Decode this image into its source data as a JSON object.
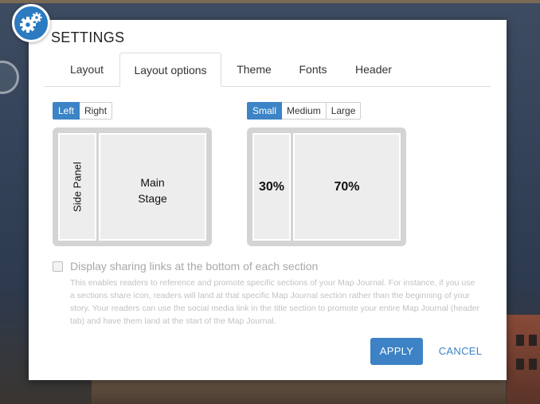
{
  "dialog": {
    "title": "SETTINGS",
    "icon": "gears-icon",
    "accent_color": "#3d82c4"
  },
  "tabs": [
    {
      "label": "Layout",
      "active": false
    },
    {
      "label": "Layout options",
      "active": true
    },
    {
      "label": "Theme",
      "active": false
    },
    {
      "label": "Fonts",
      "active": false
    },
    {
      "label": "Header",
      "active": false
    }
  ],
  "panel_position": {
    "options": [
      "Left",
      "Right"
    ],
    "selected": "Left",
    "preview": {
      "side_label": "Side Panel",
      "main_label_line1": "Main",
      "main_label_line2": "Stage"
    }
  },
  "panel_size": {
    "options": [
      "Small",
      "Medium",
      "Large"
    ],
    "selected": "Small",
    "preview": {
      "side_pct": "30%",
      "main_pct": "70%"
    }
  },
  "sharing": {
    "checked": false,
    "label": "Display sharing links at the bottom of each section",
    "description": "This enables readers to reference and promote specific sections of your Map Journal. For instance, if you use a sections share icon, readers will land at that specific Map Journal section rather than the beginning of your story. Your readers can use the social media link in the title section to promote your entire Map Journal (header tab) and have them land at the start of the Map Journal."
  },
  "buttons": {
    "apply": "APPLY",
    "cancel": "CANCEL"
  }
}
